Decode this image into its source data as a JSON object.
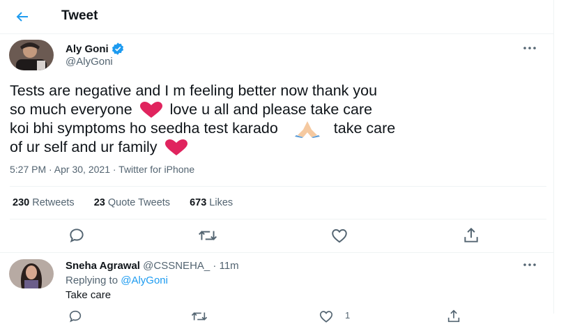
{
  "header": {
    "title": "Tweet"
  },
  "tweet": {
    "author_name": "Aly Goni",
    "author_handle": "@AlyGoni",
    "text_lines": [
      "Tests are negative and I m feeling better now thank you",
      "so much everyone",
      "love u all and please take care",
      "koi bhi symptoms ho seedha test karado",
      "take care",
      "of ur self and ur family"
    ],
    "meta": "5:27 PM · Apr 30, 2021 · Twitter for iPhone",
    "stats": {
      "retweets_count": "230",
      "retweets_label": "Retweets",
      "quotes_count": "23",
      "quotes_label": "Quote Tweets",
      "likes_count": "673",
      "likes_label": "Likes"
    }
  },
  "reply": {
    "author_name": "Sneha Agrawal",
    "author_handle": "@CSSNEHA_",
    "separator": "·",
    "time": "11m",
    "replying_prefix": "Replying to",
    "replying_handle": "@AlyGoni",
    "text": "Take care",
    "like_count": "1"
  },
  "colors": {
    "accent": "#1d9bf0",
    "heart": "#e0245e",
    "muted": "#536471"
  },
  "icons": [
    "back-arrow-icon",
    "verified-badge-icon",
    "more-dots-icon",
    "heart-emoji-icon",
    "folded-hands-emoji-icon",
    "reply-icon",
    "retweet-icon",
    "like-icon",
    "share-icon"
  ]
}
